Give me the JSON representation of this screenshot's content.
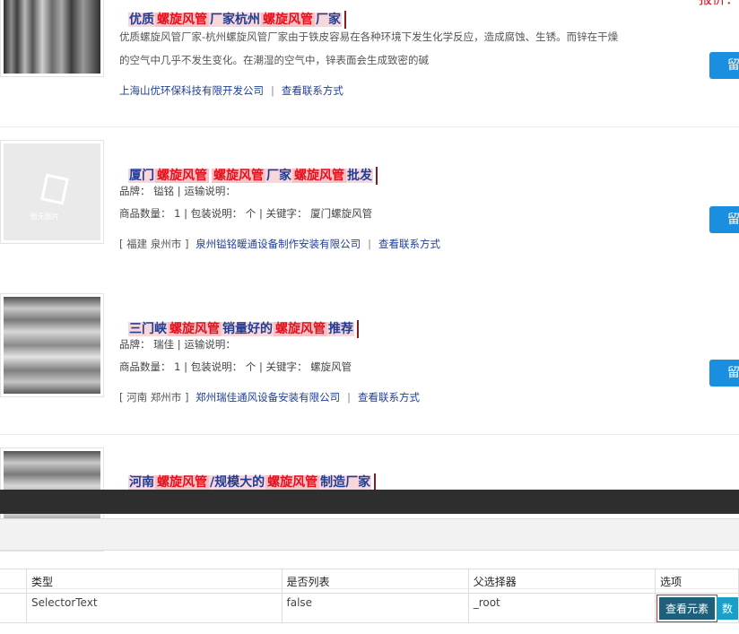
{
  "listings": [
    {
      "title_parts": [
        {
          "t": "优质",
          "hl": false
        },
        {
          "t": "螺旋风管",
          "hl": true
        },
        {
          "t": "厂家杭州",
          "hl": false
        },
        {
          "t": "螺旋风管",
          "hl": true
        },
        {
          "t": "厂家",
          "hl": false
        }
      ],
      "desc1": "优质螺旋风管厂家-杭州螺旋风管厂家由于铁皮容易在各种环境下发生化学反应，造成腐蚀、生锈。而锌在干燥",
      "desc2": "的空气中几乎不发生变化。在潮湿的空气中，锌表面会生成致密的碱",
      "company": "上海山优环保科技有限开发公司",
      "contact": "查看联系方式",
      "price": "报价：",
      "message": "留"
    },
    {
      "title_parts": [
        {
          "t": "厦门",
          "hl": false
        },
        {
          "t": "螺旋风管",
          "hl": true
        },
        {
          "t": "螺旋风管",
          "hl": true
        },
        {
          "t": "厂家",
          "hl": false
        },
        {
          "t": "螺旋风管",
          "hl": true
        },
        {
          "t": "批发",
          "hl": false
        }
      ],
      "brand": "品牌： 镒铭 | 运输说明：",
      "qty": "商品数量： 1 | 包装说明： 个 | 关键字： 厦门螺旋风管",
      "location": "[ 福建 泉州市 ]",
      "company": "泉州镒铭暖通设备制作安装有限公司",
      "contact": "查看联系方式",
      "placeholder_text": "暂无图片",
      "message": "留"
    },
    {
      "title_parts": [
        {
          "t": "三门峡",
          "hl": false
        },
        {
          "t": "螺旋风管",
          "hl": true
        },
        {
          "t": "销量好的",
          "hl": false
        },
        {
          "t": "螺旋风管",
          "hl": true
        },
        {
          "t": "推荐",
          "hl": false
        }
      ],
      "brand": "品牌： 瑞佳 | 运输说明：",
      "qty": "商品数量： 1 | 包装说明： 个 | 关键字： 螺旋风管",
      "location": "[ 河南 郑州市 ]",
      "company": "郑州瑞佳通风设备安装有限公司",
      "contact": "查看联系方式",
      "message": "留"
    },
    {
      "title_parts": [
        {
          "t": "河南",
          "hl": false
        },
        {
          "t": "螺旋风管",
          "hl": true
        },
        {
          "t": "/规模大的",
          "hl": false
        },
        {
          "t": "螺旋风管",
          "hl": true
        },
        {
          "t": "制造厂家",
          "hl": false
        }
      ]
    }
  ],
  "panel": {
    "columns": [
      "类型",
      "是否列表",
      "父选择器",
      "选项"
    ],
    "row": {
      "type": "SelectorText",
      "is_list": "false",
      "parent": "_root",
      "view_button": "查看元素",
      "extra_button": "数"
    }
  },
  "colors": {
    "highlight_bg": "#f5c2c7",
    "highlight_text": "#e4101c",
    "title_blue": "#1f3e96",
    "button_blue": "#1a8fe0",
    "panel_dark": "#2e2e2e"
  }
}
